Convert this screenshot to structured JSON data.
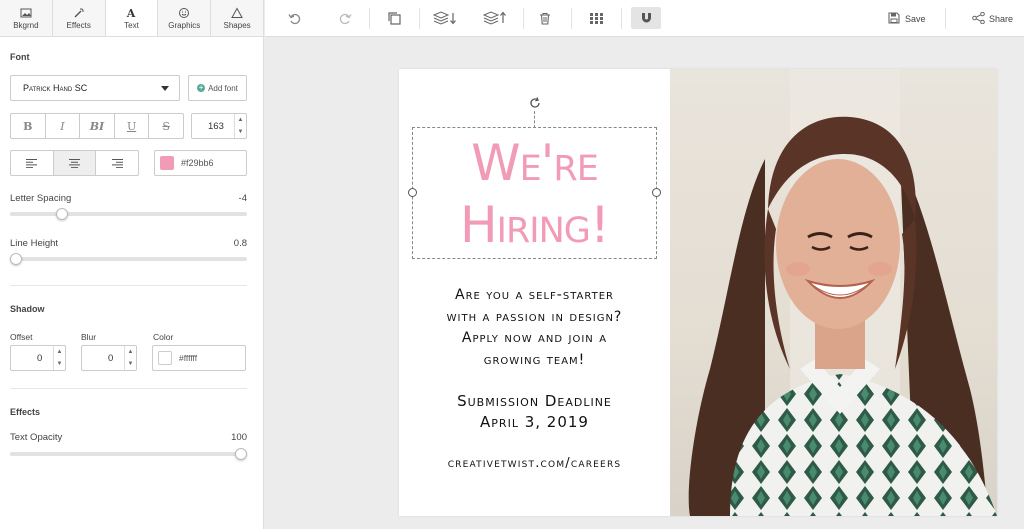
{
  "tabs": [
    {
      "label": "Bkgrnd",
      "icon": "image-icon"
    },
    {
      "label": "Effects",
      "icon": "magic-wand-icon"
    },
    {
      "label": "Text",
      "icon": "text-icon"
    },
    {
      "label": "Graphics",
      "icon": "smiley-icon"
    },
    {
      "label": "Shapes",
      "icon": "triangle-icon"
    }
  ],
  "font": {
    "section_title": "Font",
    "family": "Patrick Hand SC",
    "add_font_label": "Add font",
    "size": "163",
    "format_buttons": [
      "B",
      "I",
      "BI",
      "U",
      "S"
    ],
    "color_hex": "#f29bb6",
    "color": "#f29bb6",
    "letter_spacing_label": "Letter Spacing",
    "letter_spacing_value": "-4",
    "line_height_label": "Line Height",
    "line_height_value": "0.8"
  },
  "shadow": {
    "section_title": "Shadow",
    "offset_label": "Offset",
    "offset_value": "0",
    "blur_label": "Blur",
    "blur_value": "0",
    "color_label": "Color",
    "color_hex": "#ffffff"
  },
  "effects": {
    "section_title": "Effects",
    "opacity_label": "Text Opacity",
    "opacity_value": "100"
  },
  "toolbar": {
    "save_label": "Save",
    "share_label": "Share"
  },
  "poster": {
    "headline_line1": "We're",
    "headline_line2": "Hiring!",
    "body_lines": [
      "Are you a self-starter",
      "with a passion in design?",
      "Apply now and join a",
      "growing team!"
    ],
    "deadline_line1": "Submission Deadline",
    "deadline_line2": "April 3, 2019",
    "url": "creativetwist.com/careers"
  }
}
